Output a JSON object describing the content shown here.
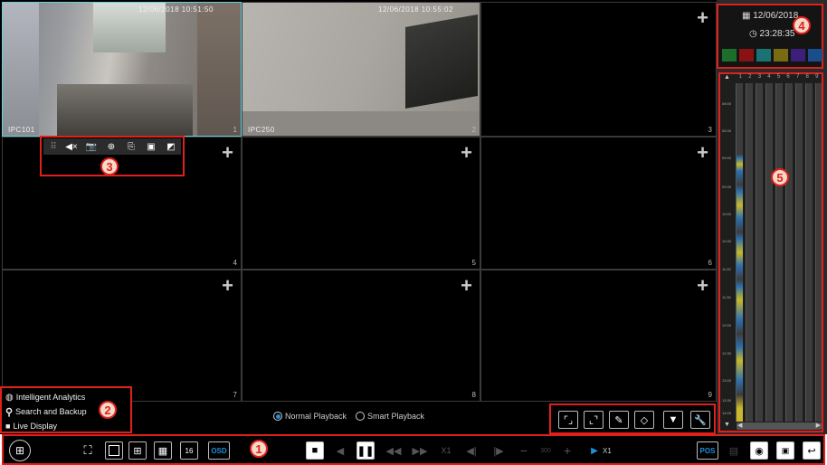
{
  "channels": [
    {
      "num": "1",
      "name": "IPC101",
      "timestamp": "12/06/2018 10:51:50"
    },
    {
      "num": "2",
      "name": "IPC250",
      "timestamp": "12/06/2018 10:55:02"
    },
    {
      "num": "3"
    },
    {
      "num": "4"
    },
    {
      "num": "5"
    },
    {
      "num": "6"
    },
    {
      "num": "7"
    },
    {
      "num": "8"
    },
    {
      "num": "9"
    }
  ],
  "markers": {
    "m1": "1",
    "m2": "2",
    "m3": "3",
    "m4": "4",
    "m5": "5"
  },
  "side_menu": {
    "analytics": "Intelligent Analytics",
    "search": "Search and Backup",
    "live": "Live Display"
  },
  "playback_mode": {
    "normal": "Normal Playback",
    "smart": "Smart Playback",
    "selected": "normal"
  },
  "datetime": {
    "date": "12/06/2018",
    "time": "23:28:35"
  },
  "timeline": {
    "channels": [
      "1",
      "2",
      "3",
      "4",
      "5",
      "6",
      "7",
      "8",
      "9"
    ],
    "times": [
      "08:00",
      "08:30",
      "09:00",
      "09:30",
      "10:00",
      "10:30",
      "11:00",
      "11:30",
      "12:00",
      "12:30",
      "13:00",
      "13:30",
      "14:00"
    ]
  },
  "toolbar": {
    "osd": "OSD",
    "speed": "X1",
    "step": "X1",
    "pos": "POS",
    "counter": "300"
  },
  "colors": {
    "accent": "#1e90d8",
    "marker": "#e0201c"
  }
}
